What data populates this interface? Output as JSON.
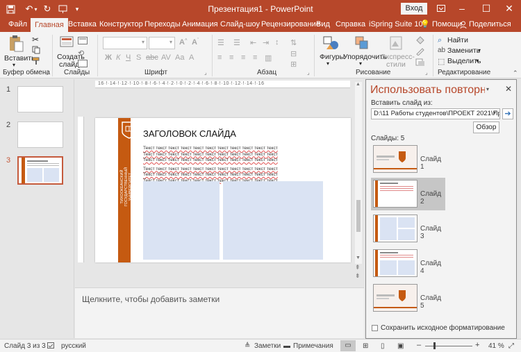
{
  "window": {
    "title": "Презентация1  -  PowerPoint",
    "login_label": "Вход"
  },
  "tabs": [
    "Файл",
    "Главная",
    "Вставка",
    "Конструктор",
    "Переходы",
    "Анимация",
    "Слайд-шоу",
    "Рецензирование",
    "Вид",
    "Справка",
    "iSpring Suite 10"
  ],
  "tabs_right": {
    "help": "Помощи",
    "share": "Поделиться"
  },
  "ribbon": {
    "clipboard": {
      "paste": "Вставить",
      "group": "Буфер обмена"
    },
    "slides": {
      "new_line1": "Создать",
      "new_line2": "слайд",
      "group": "Слайды"
    },
    "font": {
      "group": "Шрифт"
    },
    "paragraph": {
      "group": "Абзац"
    },
    "drawing": {
      "shapes": "Фигуры",
      "arrange": "Упорядочить",
      "styles_line1": "Экспресс-",
      "styles_line2": "стили",
      "group": "Рисование"
    },
    "editing": {
      "find": "Найти",
      "replace": "Заменить",
      "select": "Выделить",
      "group": "Редактирование"
    }
  },
  "thumbnails": [
    {
      "num": "1"
    },
    {
      "num": "2"
    },
    {
      "num": "3"
    }
  ],
  "slide": {
    "heading": "ЗАГОЛОВОК СЛАЙДА",
    "body_line": "Текст текст текст текст текст текст текст текст текст текст текст",
    "side_text": "ТИХООКЕАНСКИЙ ГОСУДАРСТВЕННЫЙ УНИВЕРСИТЕТ"
  },
  "notes_placeholder": "Щелкните, чтобы добавить заметки",
  "reuse_pane": {
    "title": "Использовать повторно",
    "insert_from_label": "Вставить слайд из:",
    "path": "D:\\11 Работы студентов\\ПРОЕКТ 2021\\Презе",
    "browse": "Обзор",
    "count_label": "Слайды: 5",
    "slides": [
      "Слайд 1",
      "Слайд 2",
      "Слайд 3",
      "Слайд 4",
      "Слайд 5"
    ],
    "keep_format": "Сохранить исходное форматирование"
  },
  "status": {
    "slide_info": "Слайд 3 из 3",
    "language": "русский",
    "notes": "Заметки",
    "comments": "Примечания",
    "zoom": "41 %"
  },
  "colors": {
    "accent": "#b7472a",
    "brand_orange": "#c55a11",
    "placeholder": "#dae3f3"
  }
}
